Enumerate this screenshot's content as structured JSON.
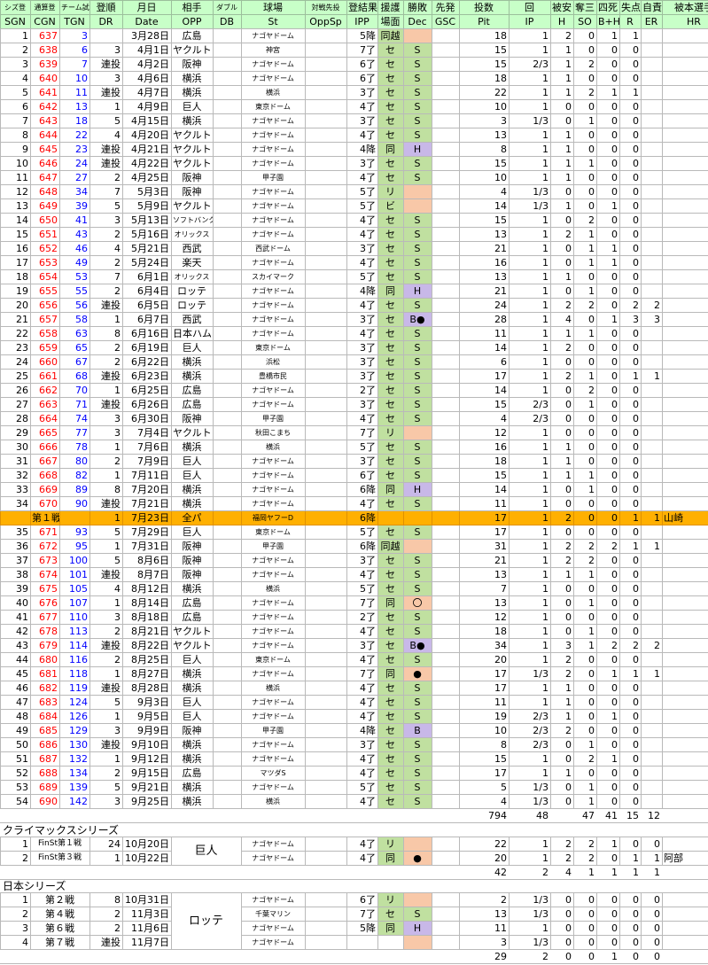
{
  "header": {
    "ja": [
      "シズ登",
      "通算登",
      "チーム試",
      "登順",
      "月日",
      "相手",
      "ダブル",
      "球場",
      "対戦先投",
      "登結果",
      "援護",
      "勝敗",
      "先発",
      "投数",
      "回",
      "被安",
      "奪三",
      "四死",
      "失点",
      "自責",
      "被本選手"
    ],
    "en": [
      "SGN",
      "CGN",
      "TGN",
      "DR",
      "Date",
      "OPP",
      "DB",
      "St",
      "OppSp",
      "IPP",
      "場面",
      "Dec",
      "GSC",
      "Pit",
      "IP",
      "H",
      "SO",
      "B+H",
      "R",
      "ER",
      "HR"
    ]
  },
  "season_rows": [
    [
      "1",
      "637",
      "3",
      "",
      "3月28日",
      "広島",
      "",
      "ナゴヤドーム",
      "",
      "5降",
      "同越",
      "",
      "",
      "18",
      "1",
      "2",
      "0",
      "1",
      "1",
      ""
    ],
    [
      "2",
      "638",
      "6",
      "3",
      "4月1日",
      "ヤクルト",
      "",
      "神宮",
      "",
      "7了",
      "セ",
      "S",
      "",
      "15",
      "1",
      "1",
      "0",
      "0",
      "0",
      ""
    ],
    [
      "3",
      "639",
      "7",
      "連投",
      "4月2日",
      "阪神",
      "",
      "ナゴヤドーム",
      "",
      "6了",
      "セ",
      "S",
      "",
      "15",
      "2/3",
      "1",
      "2",
      "0",
      "0",
      ""
    ],
    [
      "4",
      "640",
      "10",
      "3",
      "4月6日",
      "横浜",
      "",
      "ナゴヤドーム",
      "",
      "6了",
      "セ",
      "S",
      "",
      "18",
      "1",
      "1",
      "0",
      "0",
      "0",
      ""
    ],
    [
      "5",
      "641",
      "11",
      "連投",
      "4月7日",
      "横浜",
      "",
      "横浜",
      "",
      "3了",
      "セ",
      "S",
      "",
      "22",
      "1",
      "1",
      "2",
      "1",
      "1",
      ""
    ],
    [
      "6",
      "642",
      "13",
      "1",
      "4月9日",
      "巨人",
      "",
      "東京ドーム",
      "",
      "4了",
      "セ",
      "S",
      "",
      "10",
      "1",
      "0",
      "0",
      "0",
      "0",
      ""
    ],
    [
      "7",
      "643",
      "18",
      "5",
      "4月15日",
      "横浜",
      "",
      "ナゴヤドーム",
      "",
      "3了",
      "セ",
      "S",
      "",
      "3",
      "1/3",
      "0",
      "1",
      "0",
      "0",
      ""
    ],
    [
      "8",
      "644",
      "22",
      "4",
      "4月20日",
      "ヤクルト",
      "",
      "ナゴヤドーム",
      "",
      "4了",
      "セ",
      "S",
      "",
      "13",
      "1",
      "1",
      "0",
      "0",
      "0",
      ""
    ],
    [
      "9",
      "645",
      "23",
      "連投",
      "4月21日",
      "ヤクルト",
      "",
      "ナゴヤドーム",
      "",
      "4降",
      "同",
      "H",
      "",
      "8",
      "1",
      "1",
      "0",
      "0",
      "0",
      ""
    ],
    [
      "10",
      "646",
      "24",
      "連投",
      "4月22日",
      "ヤクルト",
      "",
      "ナゴヤドーム",
      "",
      "3了",
      "セ",
      "S",
      "",
      "15",
      "1",
      "1",
      "1",
      "0",
      "0",
      ""
    ],
    [
      "11",
      "647",
      "27",
      "2",
      "4月25日",
      "阪神",
      "",
      "甲子園",
      "",
      "4了",
      "セ",
      "S",
      "",
      "10",
      "1",
      "1",
      "0",
      "0",
      "0",
      ""
    ],
    [
      "12",
      "648",
      "34",
      "7",
      "5月3日",
      "阪神",
      "",
      "ナゴヤドーム",
      "",
      "5了",
      "リ",
      "",
      "",
      "4",
      "1/3",
      "0",
      "0",
      "0",
      "0",
      ""
    ],
    [
      "13",
      "649",
      "39",
      "5",
      "5月9日",
      "ヤクルト",
      "",
      "ナゴヤドーム",
      "",
      "5了",
      "ビ",
      "",
      "",
      "14",
      "1/3",
      "1",
      "0",
      "1",
      "0",
      ""
    ],
    [
      "14",
      "650",
      "41",
      "3",
      "5月13日",
      "ソフトバンク",
      "",
      "ナゴヤドーム",
      "",
      "4了",
      "セ",
      "S",
      "",
      "15",
      "1",
      "0",
      "2",
      "0",
      "0",
      ""
    ],
    [
      "15",
      "651",
      "43",
      "2",
      "5月16日",
      "オリックス",
      "",
      "ナゴヤドーム",
      "",
      "4了",
      "セ",
      "S",
      "",
      "13",
      "1",
      "2",
      "1",
      "0",
      "0",
      ""
    ],
    [
      "16",
      "652",
      "46",
      "4",
      "5月21日",
      "西武",
      "",
      "西武ドーム",
      "",
      "3了",
      "セ",
      "S",
      "",
      "21",
      "1",
      "0",
      "1",
      "1",
      "0",
      ""
    ],
    [
      "17",
      "653",
      "49",
      "2",
      "5月24日",
      "楽天",
      "",
      "ナゴヤドーム",
      "",
      "4了",
      "セ",
      "S",
      "",
      "16",
      "1",
      "0",
      "1",
      "1",
      "0",
      ""
    ],
    [
      "18",
      "654",
      "53",
      "7",
      "6月1日",
      "オリックス",
      "",
      "スカイマーク",
      "",
      "5了",
      "セ",
      "S",
      "",
      "13",
      "1",
      "1",
      "0",
      "0",
      "0",
      ""
    ],
    [
      "19",
      "655",
      "55",
      "2",
      "6月4日",
      "ロッテ",
      "",
      "ナゴヤドーム",
      "",
      "4降",
      "同",
      "H",
      "",
      "21",
      "1",
      "0",
      "1",
      "0",
      "0",
      ""
    ],
    [
      "20",
      "656",
      "56",
      "連投",
      "6月5日",
      "ロッテ",
      "",
      "ナゴヤドーム",
      "",
      "4了",
      "セ",
      "S",
      "",
      "24",
      "1",
      "2",
      "2",
      "0",
      "2",
      "2"
    ],
    [
      "21",
      "657",
      "58",
      "1",
      "6月7日",
      "西武",
      "",
      "ナゴヤドーム",
      "",
      "3了",
      "セ",
      "B●",
      "",
      "28",
      "1",
      "4",
      "0",
      "1",
      "3",
      "3"
    ],
    [
      "22",
      "658",
      "63",
      "8",
      "6月16日",
      "日本ハム",
      "",
      "ナゴヤドーム",
      "",
      "4了",
      "セ",
      "S",
      "",
      "11",
      "1",
      "1",
      "1",
      "0",
      "0",
      ""
    ],
    [
      "23",
      "659",
      "65",
      "2",
      "6月19日",
      "巨人",
      "",
      "東京ドーム",
      "",
      "3了",
      "セ",
      "S",
      "",
      "14",
      "1",
      "2",
      "0",
      "0",
      "0",
      ""
    ],
    [
      "24",
      "660",
      "67",
      "2",
      "6月22日",
      "横浜",
      "",
      "浜松",
      "",
      "3了",
      "セ",
      "S",
      "",
      "6",
      "1",
      "0",
      "0",
      "0",
      "0",
      ""
    ],
    [
      "25",
      "661",
      "68",
      "連投",
      "6月23日",
      "横浜",
      "",
      "豊橋市民",
      "",
      "3了",
      "セ",
      "S",
      "",
      "17",
      "1",
      "2",
      "1",
      "0",
      "1",
      "1"
    ],
    [
      "26",
      "662",
      "70",
      "1",
      "6月25日",
      "広島",
      "",
      "ナゴヤドーム",
      "",
      "2了",
      "セ",
      "S",
      "",
      "14",
      "1",
      "0",
      "2",
      "0",
      "0",
      ""
    ],
    [
      "27",
      "663",
      "71",
      "連投",
      "6月26日",
      "広島",
      "",
      "ナゴヤドーム",
      "",
      "3了",
      "セ",
      "S",
      "",
      "15",
      "2/3",
      "0",
      "1",
      "0",
      "0",
      ""
    ],
    [
      "28",
      "664",
      "74",
      "3",
      "6月30日",
      "阪神",
      "",
      "甲子園",
      "",
      "4了",
      "セ",
      "S",
      "",
      "4",
      "2/3",
      "0",
      "0",
      "0",
      "0",
      ""
    ],
    [
      "29",
      "665",
      "77",
      "3",
      "7月4日",
      "ヤクルト",
      "",
      "秋田こまち",
      "",
      "7了",
      "リ",
      "",
      "",
      "12",
      "1",
      "0",
      "0",
      "0",
      "0",
      ""
    ],
    [
      "30",
      "666",
      "78",
      "1",
      "7月6日",
      "横浜",
      "",
      "横浜",
      "",
      "5了",
      "セ",
      "S",
      "",
      "16",
      "1",
      "1",
      "0",
      "0",
      "0",
      ""
    ],
    [
      "31",
      "667",
      "80",
      "2",
      "7月9日",
      "巨人",
      "",
      "ナゴヤドーム",
      "",
      "3了",
      "セ",
      "S",
      "",
      "18",
      "1",
      "1",
      "0",
      "0",
      "0",
      ""
    ],
    [
      "32",
      "668",
      "82",
      "1",
      "7月11日",
      "巨人",
      "",
      "ナゴヤドーム",
      "",
      "6了",
      "セ",
      "S",
      "",
      "15",
      "1",
      "1",
      "1",
      "0",
      "0",
      ""
    ],
    [
      "33",
      "669",
      "89",
      "8",
      "7月20日",
      "横浜",
      "",
      "ナゴヤドーム",
      "",
      "6降",
      "同",
      "H",
      "",
      "14",
      "1",
      "0",
      "1",
      "0",
      "0",
      ""
    ],
    [
      "34",
      "670",
      "90",
      "連投",
      "7月21日",
      "横浜",
      "",
      "ナゴヤドーム",
      "",
      "4了",
      "セ",
      "S",
      "",
      "11",
      "1",
      "0",
      "0",
      "0",
      "0",
      ""
    ]
  ],
  "allstar_row": [
    "",
    "第１戦",
    "",
    "1",
    "7月23日",
    "全パ",
    "",
    "福岡ヤフーD",
    "",
    "6降",
    "",
    "",
    "",
    "17",
    "1",
    "2",
    "0",
    "0",
    "1",
    "1",
    "山崎"
  ],
  "season_rows2": [
    [
      "35",
      "671",
      "93",
      "5",
      "7月29日",
      "巨人",
      "",
      "東京ドーム",
      "",
      "5了",
      "セ",
      "S",
      "",
      "17",
      "1",
      "0",
      "0",
      "0",
      "0",
      ""
    ],
    [
      "36",
      "672",
      "95",
      "1",
      "7月31日",
      "阪神",
      "",
      "甲子園",
      "",
      "6降",
      "同越",
      "",
      "",
      "31",
      "1",
      "2",
      "2",
      "2",
      "1",
      "1"
    ],
    [
      "37",
      "673",
      "100",
      "5",
      "8月6日",
      "阪神",
      "",
      "ナゴヤドーム",
      "",
      "3了",
      "セ",
      "S",
      "",
      "21",
      "1",
      "2",
      "2",
      "0",
      "0",
      ""
    ],
    [
      "38",
      "674",
      "101",
      "連投",
      "8月7日",
      "阪神",
      "",
      "ナゴヤドーム",
      "",
      "4了",
      "セ",
      "S",
      "",
      "13",
      "1",
      "1",
      "1",
      "0",
      "0",
      ""
    ],
    [
      "39",
      "675",
      "105",
      "4",
      "8月12日",
      "横浜",
      "",
      "横浜",
      "",
      "5了",
      "セ",
      "S",
      "",
      "7",
      "1",
      "0",
      "0",
      "0",
      "0",
      ""
    ],
    [
      "40",
      "676",
      "107",
      "1",
      "8月14日",
      "広島",
      "",
      "ナゴヤドーム",
      "",
      "7了",
      "同",
      "〇",
      "",
      "13",
      "1",
      "0",
      "1",
      "0",
      "0",
      ""
    ],
    [
      "41",
      "677",
      "110",
      "3",
      "8月18日",
      "広島",
      "",
      "ナゴヤドーム",
      "",
      "2了",
      "セ",
      "S",
      "",
      "12",
      "1",
      "0",
      "0",
      "0",
      "0",
      ""
    ],
    [
      "42",
      "678",
      "113",
      "2",
      "8月21日",
      "ヤクルト",
      "",
      "ナゴヤドーム",
      "",
      "4了",
      "セ",
      "S",
      "",
      "18",
      "1",
      "0",
      "1",
      "0",
      "0",
      ""
    ],
    [
      "43",
      "679",
      "114",
      "連投",
      "8月22日",
      "ヤクルト",
      "",
      "ナゴヤドーム",
      "",
      "3了",
      "セ",
      "B●",
      "",
      "34",
      "1",
      "3",
      "1",
      "2",
      "2",
      "2"
    ],
    [
      "44",
      "680",
      "116",
      "2",
      "8月25日",
      "巨人",
      "",
      "東京ドーム",
      "",
      "4了",
      "セ",
      "S",
      "",
      "20",
      "1",
      "2",
      "0",
      "0",
      "0",
      ""
    ],
    [
      "45",
      "681",
      "118",
      "1",
      "8月27日",
      "横浜",
      "",
      "ナゴヤドーム",
      "",
      "7了",
      "同",
      "●",
      "",
      "17",
      "1/3",
      "2",
      "0",
      "1",
      "1",
      "1"
    ],
    [
      "46",
      "682",
      "119",
      "連投",
      "8月28日",
      "横浜",
      "",
      "横浜",
      "",
      "4了",
      "セ",
      "S",
      "",
      "17",
      "1",
      "1",
      "0",
      "0",
      "0",
      ""
    ],
    [
      "47",
      "683",
      "124",
      "5",
      "9月3日",
      "巨人",
      "",
      "ナゴヤドーム",
      "",
      "4了",
      "セ",
      "S",
      "",
      "11",
      "1",
      "1",
      "0",
      "0",
      "0",
      ""
    ],
    [
      "48",
      "684",
      "126",
      "1",
      "9月5日",
      "巨人",
      "",
      "ナゴヤドーム",
      "",
      "4了",
      "セ",
      "S",
      "",
      "19",
      "2/3",
      "1",
      "0",
      "1",
      "0",
      ""
    ],
    [
      "49",
      "685",
      "129",
      "3",
      "9月9日",
      "阪神",
      "",
      "甲子園",
      "",
      "4降",
      "セ",
      "B",
      "",
      "10",
      "2/3",
      "2",
      "0",
      "0",
      "0",
      ""
    ],
    [
      "50",
      "686",
      "130",
      "連投",
      "9月10日",
      "横浜",
      "",
      "ナゴヤドーム",
      "",
      "3了",
      "セ",
      "S",
      "",
      "8",
      "2/3",
      "0",
      "1",
      "0",
      "0",
      ""
    ],
    [
      "51",
      "687",
      "132",
      "1",
      "9月12日",
      "横浜",
      "",
      "ナゴヤドーム",
      "",
      "4了",
      "セ",
      "S",
      "",
      "15",
      "1",
      "0",
      "2",
      "1",
      "0",
      ""
    ],
    [
      "52",
      "688",
      "134",
      "2",
      "9月15日",
      "広島",
      "",
      "マツダS",
      "",
      "4了",
      "セ",
      "S",
      "",
      "17",
      "1",
      "1",
      "0",
      "0",
      "0",
      ""
    ],
    [
      "53",
      "689",
      "139",
      "5",
      "9月21日",
      "横浜",
      "",
      "ナゴヤドーム",
      "",
      "5了",
      "セ",
      "S",
      "",
      "5",
      "1/3",
      "0",
      "1",
      "0",
      "0",
      ""
    ],
    [
      "54",
      "690",
      "142",
      "3",
      "9月25日",
      "横浜",
      "",
      "横浜",
      "",
      "4了",
      "セ",
      "S",
      "",
      "4",
      "1/3",
      "0",
      "1",
      "0",
      "0",
      ""
    ]
  ],
  "season_total": [
    "794",
    "48",
    "47",
    "41",
    "15",
    "12",
    "12",
    "1"
  ],
  "climax": {
    "title": "クライマックスシリーズ",
    "opp": "巨人",
    "rows": [
      [
        "1",
        "FinSt第１戦",
        "24",
        "10月20日",
        "ナゴヤドーム",
        "4了",
        "リ",
        "",
        "22",
        "1",
        "2",
        "2",
        "1",
        "0",
        "0",
        ""
      ],
      [
        "2",
        "FinSt第３戦",
        "1",
        "10月22日",
        "ナゴヤドーム",
        "4了",
        "同",
        "●",
        "20",
        "1",
        "2",
        "2",
        "0",
        "1",
        "1",
        "阿部"
      ]
    ],
    "total": [
      "42",
      "2",
      "4",
      "1",
      "1",
      "1",
      "1"
    ]
  },
  "japan": {
    "title": "日本シリーズ",
    "opp": "ロッテ",
    "rows": [
      [
        "1",
        "第２戦",
        "8",
        "10月31日",
        "ナゴヤドーム",
        "6了",
        "リ",
        "",
        "2",
        "1/3",
        "0",
        "0",
        "0",
        "0",
        "0",
        ""
      ],
      [
        "2",
        "第４戦",
        "2",
        "11月3日",
        "千葉マリン",
        "7了",
        "セ",
        "S",
        "13",
        "1/3",
        "0",
        "0",
        "0",
        "0",
        "0",
        ""
      ],
      [
        "3",
        "第６戦",
        "2",
        "11月6日",
        "ナゴヤドーム",
        "5降",
        "同",
        "H",
        "11",
        "1",
        "0",
        "0",
        "0",
        "0",
        "0",
        ""
      ],
      [
        "4",
        "第７戦",
        "連投",
        "11月7日",
        "ナゴヤドーム",
        "",
        "",
        "",
        "3",
        "1/3",
        "0",
        "0",
        "0",
        "0",
        "0",
        ""
      ]
    ],
    "total": [
      "29",
      "2",
      "0",
      "0",
      "1",
      "0",
      "0",
      "0"
    ]
  },
  "colors": {
    "header": "#c8ffc8",
    "save": "#c0e0a0",
    "hold": "#f8c8a8",
    "lose": "#c8b8e8",
    "allstar": "#ffb000",
    "red": "#ff0000",
    "blue": "#0000ff"
  }
}
